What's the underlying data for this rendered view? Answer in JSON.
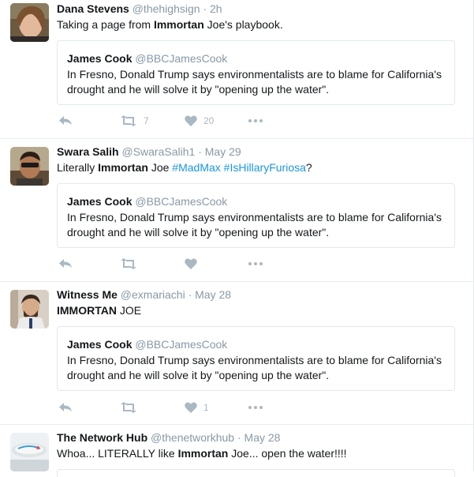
{
  "tweets": [
    {
      "fullname": "Dana Stevens",
      "username": "@thehighsign",
      "time": "2h",
      "text_parts": [
        "Taking a page from ",
        "Immortan",
        " Joe's playbook."
      ],
      "quote": {
        "name": "James Cook",
        "username": "@BBCJamesCook",
        "text": "In Fresno, Donald Trump says environmentalists are to blame for California's drought and he will solve it by \"opening up the water\"."
      },
      "retweets": "7",
      "likes": "20"
    },
    {
      "fullname": "Swara Salih",
      "username": "@SwaraSalih1",
      "time": "May 29",
      "text_parts": [
        "Literally ",
        "Immortan",
        " Joe ",
        "#MadMax",
        " ",
        "#IsHillaryFuriosa",
        "?"
      ],
      "quote": {
        "name": "James Cook",
        "username": "@BBCJamesCook",
        "text": "In Fresno, Donald Trump says environmentalists are to blame for California's drought and he will solve it by \"opening up the water\"."
      },
      "retweets": "",
      "likes": ""
    },
    {
      "fullname": "Witness Me",
      "username": "@exmariachi",
      "time": "May 28",
      "text_parts": [
        "IMMORTAN",
        " JOE"
      ],
      "quote": {
        "name": "James Cook",
        "username": "@BBCJamesCook",
        "text": "In Fresno, Donald Trump says environmentalists are to blame for California's drought and he will solve it by \"opening up the water\"."
      },
      "retweets": "",
      "likes": "1"
    },
    {
      "fullname": "The Network Hub",
      "username": "@thenetworkhub",
      "time": "May 28",
      "text_parts": [
        "Whoa... LITERALLY like ",
        "Immortan",
        " Joe... open the water!!!!"
      ]
    }
  ],
  "separator": "·",
  "colors": {
    "secondary_text": "#8899a6",
    "action_icon": "#aab8c2",
    "hashtag": "#1b95e0",
    "border": "#e1e8ed"
  },
  "icons": [
    "reply-icon",
    "retweet-icon",
    "like-icon",
    "more-icon"
  ]
}
